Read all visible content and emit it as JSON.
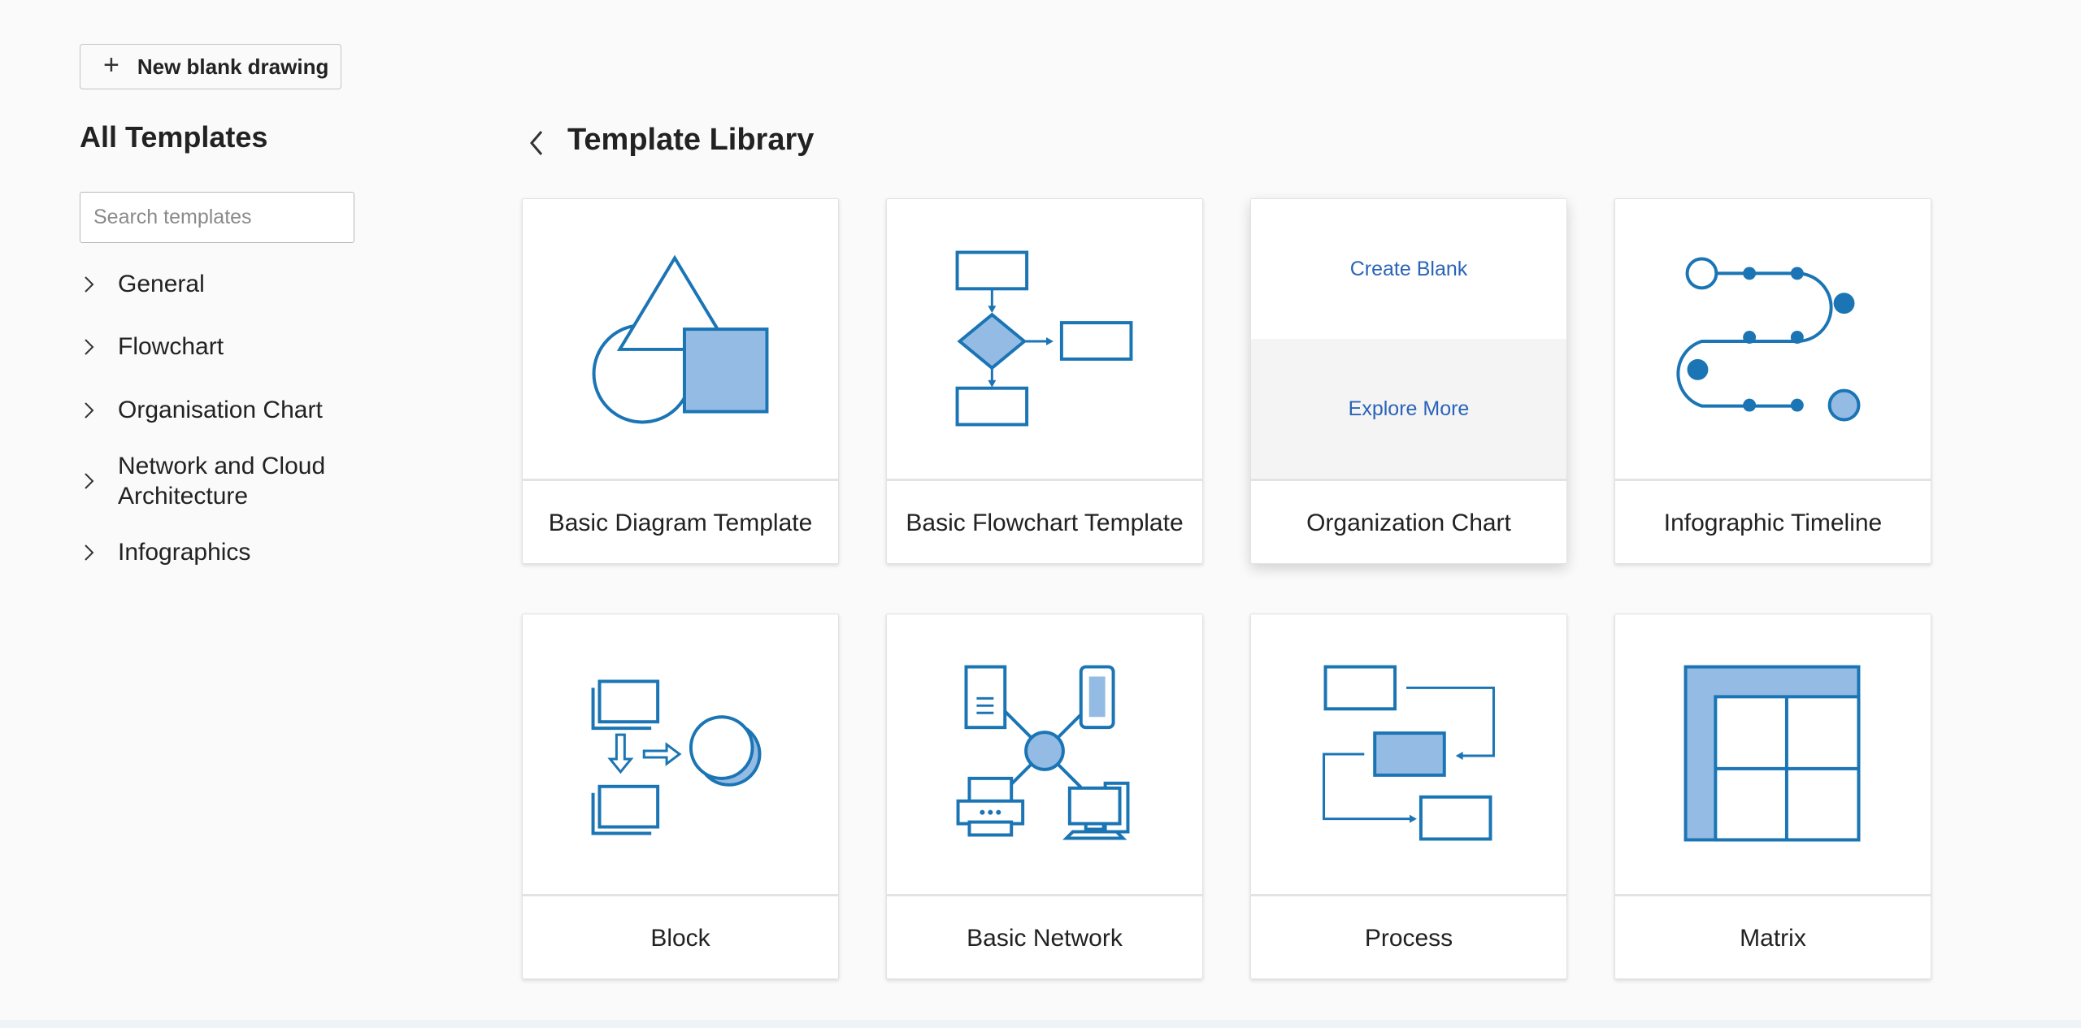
{
  "new_button": {
    "icon": "plus-icon",
    "label": "New blank drawing"
  },
  "sidebar": {
    "title": "All Templates",
    "search_placeholder": "Search templates",
    "categories": [
      {
        "label": "General"
      },
      {
        "label": "Flowchart"
      },
      {
        "label": "Organisation Chart"
      },
      {
        "label": "Network and Cloud Architecture"
      },
      {
        "label": "Infographics"
      }
    ]
  },
  "library": {
    "back_icon": "chevron-left-icon",
    "title": "Template Library",
    "cards": [
      {
        "title": "Basic Diagram Template",
        "thumbnail": "basic-diagram-thumbnail"
      },
      {
        "title": "Basic Flowchart Template",
        "thumbnail": "flowchart-thumbnail"
      },
      {
        "title": "Organization Chart",
        "create_blank": "Create Blank",
        "explore_more": "Explore More"
      },
      {
        "title": "Infographic Timeline",
        "thumbnail": "timeline-thumbnail"
      },
      {
        "title": "Block",
        "thumbnail": "block-thumbnail"
      },
      {
        "title": "Basic Network",
        "thumbnail": "network-thumbnail"
      },
      {
        "title": "Process",
        "thumbnail": "process-thumbnail"
      },
      {
        "title": "Matrix",
        "thumbnail": "matrix-thumbnail"
      }
    ]
  },
  "colors": {
    "stroke": "#1b75b4",
    "fill": "#93bbe4",
    "link": "#2a64b8",
    "background": "#fafafa"
  }
}
